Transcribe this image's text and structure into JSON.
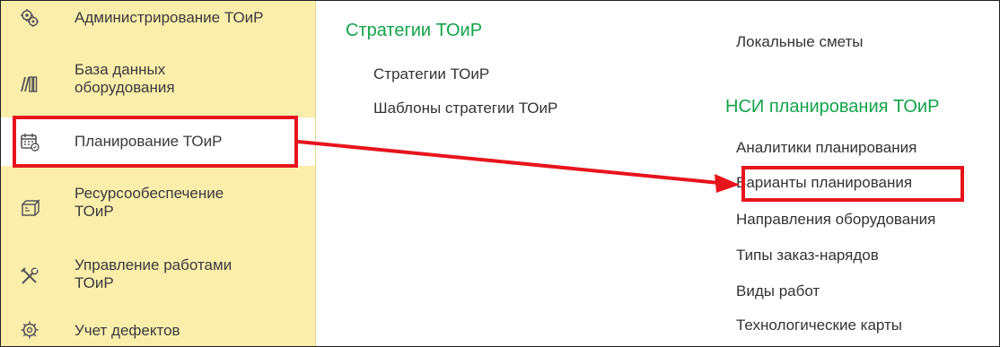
{
  "sidebar": {
    "items": [
      {
        "label": "Администрирование ТОиР",
        "icon": "gears-icon"
      },
      {
        "label": "База данных\nоборудования",
        "icon": "database-books-icon"
      },
      {
        "label": "Планирование ТОиР",
        "icon": "calendar-plan-icon",
        "active": true
      },
      {
        "label": "Ресурсообеспечение\nТОиР",
        "icon": "resources-box-icon"
      },
      {
        "label": "Управление работами\nТОиР",
        "icon": "tools-icon"
      },
      {
        "label": "Учет дефектов",
        "icon": "defect-gear-icon"
      }
    ]
  },
  "content": {
    "column1": {
      "title": "Стратегии ТОиР",
      "links": [
        "Стратегии ТОиР",
        "Шаблоны стратегии ТОиР"
      ]
    },
    "column2": {
      "top_link": "Локальные сметы",
      "title": "НСИ планирования ТОиР",
      "links": [
        "Аналитики планирования",
        "Варианты планирования",
        "Направления оборудования",
        "Типы заказ-нарядов",
        "Виды работ",
        "Технологические карты"
      ]
    }
  },
  "colors": {
    "sidebar_bg": "#fbeeab",
    "section_title": "#13a34a",
    "highlight": "#e8141c"
  }
}
